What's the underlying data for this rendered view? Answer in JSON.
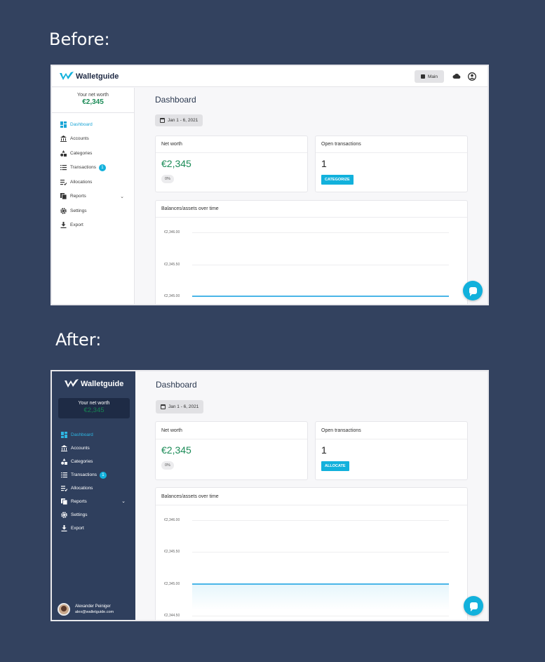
{
  "captions": {
    "before": "Before:",
    "after": "After:"
  },
  "colors": {
    "accent": "#12b1dc",
    "positive": "#1b8b57",
    "sidebar_after": "#2f3f5d",
    "page_bg": "#33425f"
  },
  "before": {
    "logo": "Walletguide",
    "topbar": {
      "main_button": "Main",
      "cloud_icon": "cloud-icon",
      "user_icon": "user-icon"
    },
    "net_worth": {
      "label": "Your net worth",
      "value": "€2,345"
    },
    "nav": [
      {
        "label": "Dashboard",
        "icon": "dashboard-icon",
        "active": true
      },
      {
        "label": "Accounts",
        "icon": "bank-icon"
      },
      {
        "label": "Categories",
        "icon": "shapes-icon"
      },
      {
        "label": "Transactions",
        "icon": "list-icon",
        "badge": "1"
      },
      {
        "label": "Allocations",
        "icon": "allocations-icon"
      },
      {
        "label": "Reports",
        "icon": "reports-icon",
        "expandable": true
      },
      {
        "label": "Settings",
        "icon": "gear-icon"
      },
      {
        "label": "Export",
        "icon": "download-icon"
      }
    ],
    "dashboard": {
      "title": "Dashboard",
      "date_range": "Jan 1 - 6, 2021",
      "net_worth_card": {
        "title": "Net worth",
        "value": "€2,345",
        "change": "0%"
      },
      "open_tx_card": {
        "title": "Open transactions",
        "value": "1",
        "button": "CATEGORIZE"
      },
      "chart_card": {
        "title": "Balances/assets over time"
      }
    }
  },
  "after": {
    "logo": "Walletguide",
    "net_worth": {
      "label": "Your net worth",
      "value": "€2,345"
    },
    "nav": [
      {
        "label": "Dashboard",
        "icon": "dashboard-icon",
        "active": true
      },
      {
        "label": "Accounts",
        "icon": "bank-icon"
      },
      {
        "label": "Categories",
        "icon": "shapes-icon"
      },
      {
        "label": "Transactions",
        "icon": "list-icon",
        "badge": "1"
      },
      {
        "label": "Allocations",
        "icon": "allocations-icon"
      },
      {
        "label": "Reports",
        "icon": "reports-icon",
        "expandable": true
      },
      {
        "label": "Settings",
        "icon": "gear-icon"
      },
      {
        "label": "Export",
        "icon": "download-icon"
      }
    ],
    "user": {
      "name": "Alexander Peiniger",
      "email": "alex@walletguide.com"
    },
    "dashboard": {
      "title": "Dashboard",
      "date_range": "Jan 1 - 6, 2021",
      "net_worth_card": {
        "title": "Net worth",
        "value": "€2,345",
        "change": "0%"
      },
      "open_tx_card": {
        "title": "Open transactions",
        "value": "1",
        "button": "ALLOCATE"
      },
      "chart_card": {
        "title": "Balances/assets over time"
      }
    }
  },
  "chart_data": [
    {
      "type": "line",
      "title": "Balances/assets over time",
      "y_ticks": [
        "€2,346.00",
        "€2,345.50",
        "€2,345.00"
      ],
      "ylim": [
        2345.0,
        2346.0
      ],
      "series": [
        {
          "values": [
            2345.0,
            2345.0
          ]
        }
      ]
    },
    {
      "type": "area",
      "title": "Balances/assets over time",
      "y_ticks": [
        "€2,346.00",
        "€2,345.50",
        "€2,345.00",
        "€2,344.50"
      ],
      "ylim": [
        2344.5,
        2346.0
      ],
      "series": [
        {
          "values": [
            2345.0,
            2345.0
          ]
        }
      ]
    }
  ]
}
